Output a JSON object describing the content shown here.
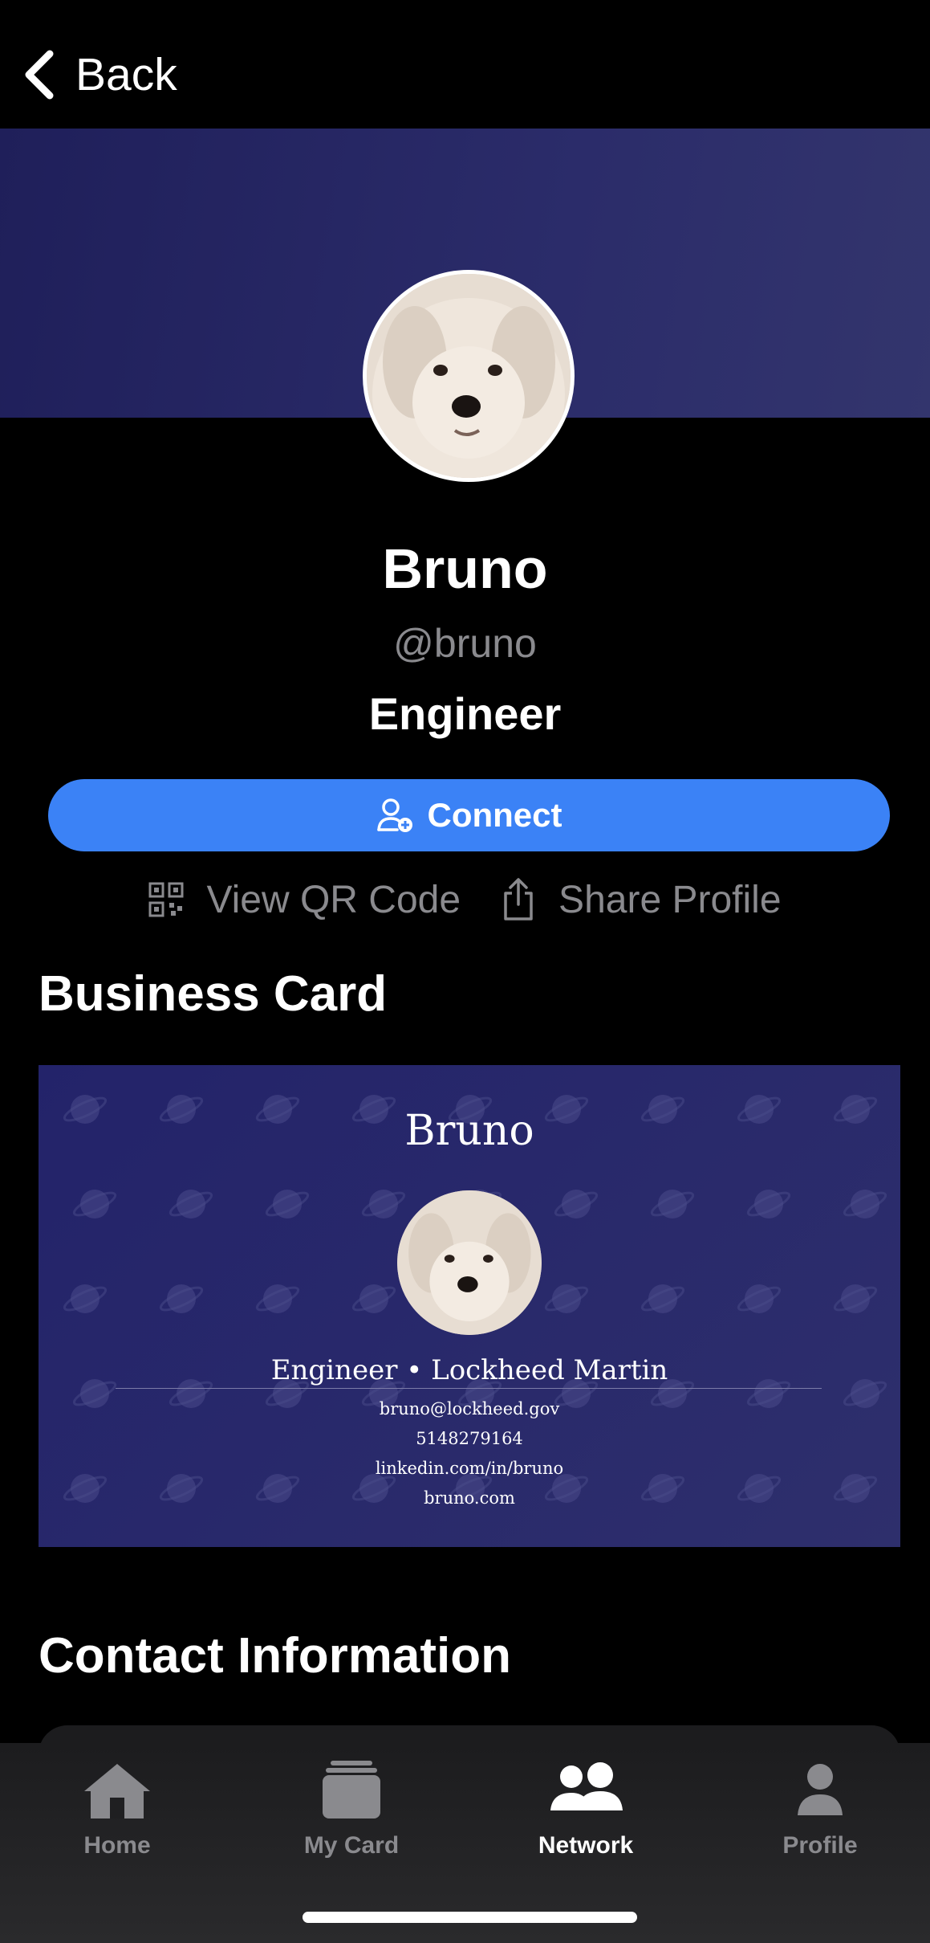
{
  "nav": {
    "back_label": "Back"
  },
  "profile": {
    "name": "Bruno",
    "handle": "@bruno",
    "title": "Engineer",
    "connect_label": "Connect",
    "view_qr_label": "View QR Code",
    "share_label": "Share Profile"
  },
  "business_card": {
    "section_title": "Business Card",
    "name": "Bruno",
    "role_line": "Engineer • Lockheed Martin",
    "email": "bruno@lockheed.gov",
    "phone": "5148279164",
    "linkedin": "linkedin.com/in/bruno",
    "website": "bruno.com"
  },
  "contact": {
    "section_title": "Contact Information"
  },
  "tabs": [
    {
      "label": "Home",
      "icon": "home-icon"
    },
    {
      "label": "My Card",
      "icon": "card-stack-icon"
    },
    {
      "label": "Network",
      "icon": "people-icon",
      "active": true
    },
    {
      "label": "Profile",
      "icon": "person-icon"
    }
  ],
  "colors": {
    "accent": "#3b82f6",
    "banner": "#2b2c6a",
    "card": "#23236a"
  }
}
